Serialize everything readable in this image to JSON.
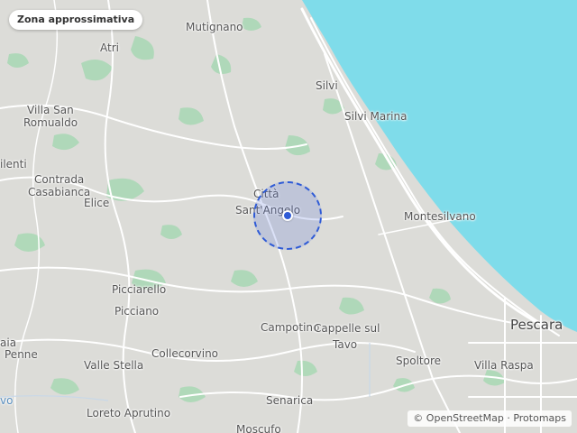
{
  "map": {
    "badge": "Zona approssimativa",
    "attribution": {
      "prefix": "©",
      "osm": "OpenStreetMap",
      "sep": "·",
      "tiles": "Protomaps"
    },
    "places": {
      "mutignano": "Mutignano",
      "atri": "Atri",
      "silvi": "Silvi",
      "silvi_marina": "Silvi Marina",
      "villa_san_romualdo_1": "Villa San",
      "villa_san_romualdo_2": "Romualdo",
      "silenti": "ilenti",
      "contrada_1": "Contrada",
      "contrada_2": "Casabianca",
      "elice": "Elice",
      "citta_1": "Città",
      "citta_2": "Sant'Angelo",
      "montesilvano": "Montesilvano",
      "picciarello": "Picciarello",
      "picciano": "Picciano",
      "campotino": "Campotino",
      "cappelle_1": "Cappelle sul",
      "cappelle_2": "Tavo",
      "pescara": "Pescara",
      "penne_1": "aia",
      "penne_2": "Penne",
      "valle_stella": "Valle Stella",
      "collecorvino": "Collecorvino",
      "spoltore": "Spoltore",
      "villa_raspa": "Villa Raspa",
      "vo": "vo",
      "senarica": "Senarica",
      "loreto": "Loreto Aprutino",
      "moscufo": "Moscufo"
    },
    "colors": {
      "land": "#dcdcd8",
      "sea": "#7fdcea",
      "park": "#a8d8b4",
      "road": "#ffffff",
      "accent": "#2f5bd6"
    },
    "location": {
      "marker": "location-dot",
      "precision": "approximate"
    }
  }
}
